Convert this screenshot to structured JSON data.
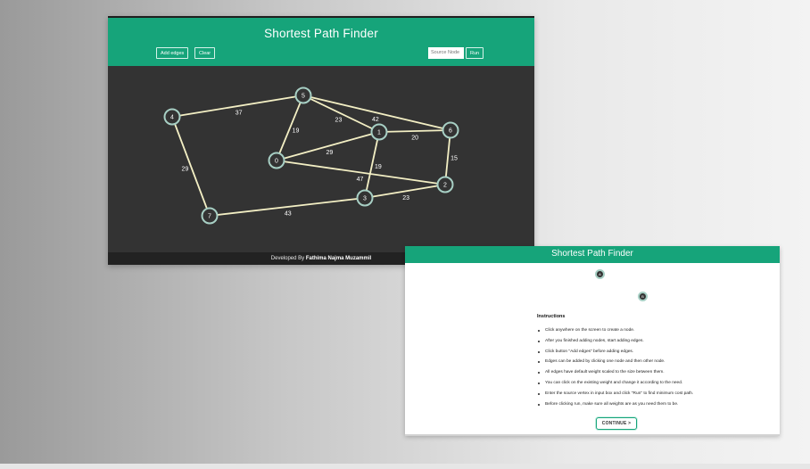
{
  "app": {
    "title": "Shortest Path Finder",
    "add_edges_label": "Add edges",
    "clear_label": "Clear",
    "source_placeholder": "Source Node",
    "run_label": "Run",
    "footer_prefix": "Developed By",
    "footer_author": "Fathima Najma Muzammil"
  },
  "graph": {
    "nodes": [
      {
        "id": "0"
      },
      {
        "id": "1"
      },
      {
        "id": "2"
      },
      {
        "id": "3"
      },
      {
        "id": "4"
      },
      {
        "id": "5"
      },
      {
        "id": "6"
      },
      {
        "id": "7"
      }
    ],
    "edges": [
      {
        "from": "4",
        "to": "5",
        "weight": "37"
      },
      {
        "from": "4",
        "to": "7",
        "weight": "29"
      },
      {
        "from": "5",
        "to": "0",
        "weight": "19"
      },
      {
        "from": "5",
        "to": "1",
        "weight": "23"
      },
      {
        "from": "5",
        "to": "6",
        "weight": "42"
      },
      {
        "from": "0",
        "to": "1",
        "weight": "29"
      },
      {
        "from": "0",
        "to": "2",
        "weight": "47"
      },
      {
        "from": "1",
        "to": "6",
        "weight": "20"
      },
      {
        "from": "1",
        "to": "3",
        "weight": "19"
      },
      {
        "from": "6",
        "to": "2",
        "weight": "15"
      },
      {
        "from": "3",
        "to": "2",
        "weight": "23"
      },
      {
        "from": "7",
        "to": "3",
        "weight": "43"
      }
    ],
    "colors": {
      "edge": "#f3efc4",
      "node_fill": "#333333",
      "node_stroke": "#a7cfc4",
      "label": "#ffffff"
    }
  },
  "modal": {
    "title": "Shortest Path Finder",
    "demo_nodes": [
      "A",
      "B"
    ],
    "instructions_title": "Instructions",
    "instructions": [
      "Click anywhere on the screen to create a node.",
      "After you finished adding nodes, start adding edges.",
      "Click button \"Add edges\" before adding edges.",
      "Edges can be added by clicking one node and then other node.",
      "All edges have default weight scaled to the size between them.",
      "You can click on the existing weight and change it according to the need.",
      "Enter the source vertex in input box and click \"Run\" to find minimum cost path.",
      "Before clicking run, make sure all weights are as you need them to be."
    ],
    "continue_label": "CONTINUE >"
  },
  "theme": {
    "primary": "#16a47a",
    "canvas": "#333333",
    "footer": "#222222"
  }
}
